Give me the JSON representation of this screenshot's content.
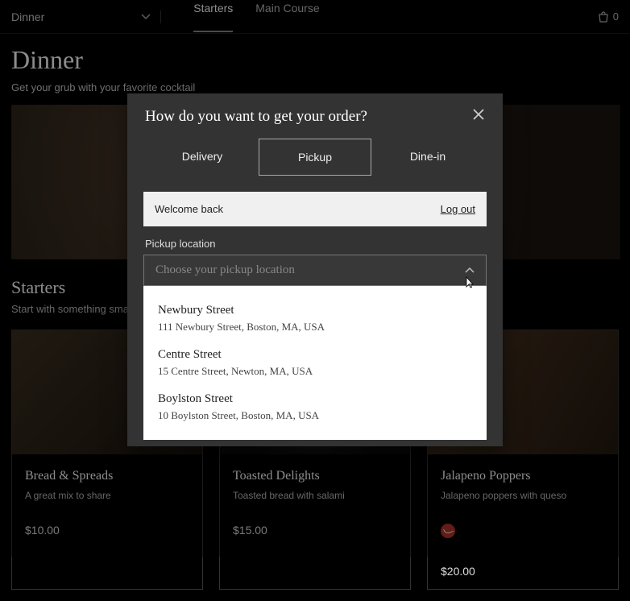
{
  "topbar": {
    "category": "Dinner",
    "tabs": [
      "Starters",
      "Main Course"
    ],
    "cart_count": "0"
  },
  "page": {
    "title": "Dinner",
    "subtitle": "Get your grub with your favorite cocktail"
  },
  "section": {
    "title": "Starters",
    "subtitle": "Start with something small"
  },
  "cards": [
    {
      "title": "Bread & Spreads",
      "desc": "A great mix to share",
      "price": "$10.00",
      "spicy": false
    },
    {
      "title": "Toasted Delights",
      "desc": "Toasted bread with salami",
      "price": "$15.00",
      "spicy": false
    },
    {
      "title": "Jalapeno Poppers",
      "desc": "Jalapeno poppers with queso",
      "price": "$20.00",
      "spicy": true
    }
  ],
  "modal": {
    "title": "How do you want to get your order?",
    "methods": [
      "Delivery",
      "Pickup",
      "Dine-in"
    ],
    "selected_method": "Pickup",
    "welcome_text": "Welcome back",
    "logout_label": "Log out",
    "field_label": "Pickup location",
    "placeholder": "Choose your pickup location",
    "options": [
      {
        "name": "Newbury Street",
        "addr": "111 Newbury Street, Boston, MA, USA"
      },
      {
        "name": "Centre Street",
        "addr": "15 Centre Street, Newton, MA, USA"
      },
      {
        "name": "Boylston Street",
        "addr": "10 Boylston Street, Boston, MA, USA"
      }
    ]
  }
}
